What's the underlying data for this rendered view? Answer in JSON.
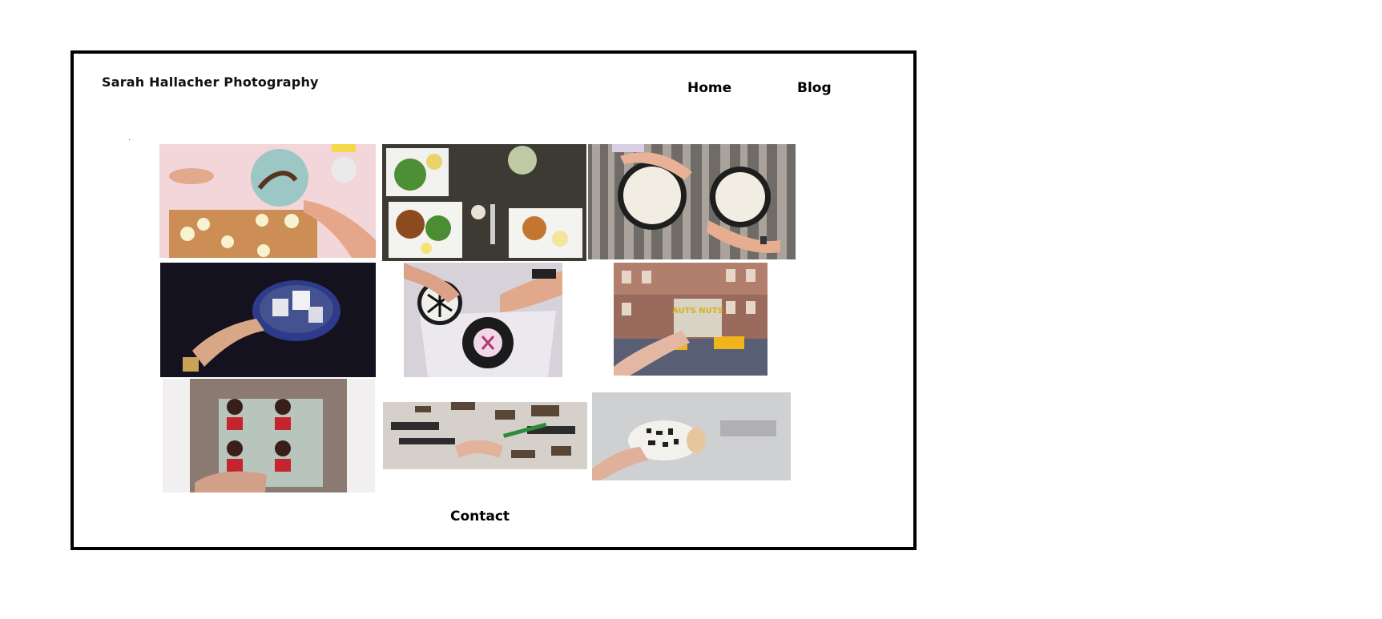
{
  "header": {
    "site_title": "Sarah Hallacher Photography"
  },
  "nav": {
    "home_label": "Home",
    "blog_label": "Blog"
  },
  "footer": {
    "contact_label": "Contact"
  },
  "gallery": {
    "photos": [
      "cooking-cucumbers-photo",
      "dinner-table-overhead-photo",
      "coffee-cups-wooden-table-photo",
      "marshmallow-mug-photo",
      "decorated-cookies-photo",
      "nyc-street-sandwich-photo",
      "portrait-prints-photo",
      "crafting-table-photo",
      "hand-holding-egg-photo"
    ],
    "sign_text": "AUTS NUTS",
    "colors": {
      "frame": "#000000",
      "background": "#ffffff"
    }
  }
}
